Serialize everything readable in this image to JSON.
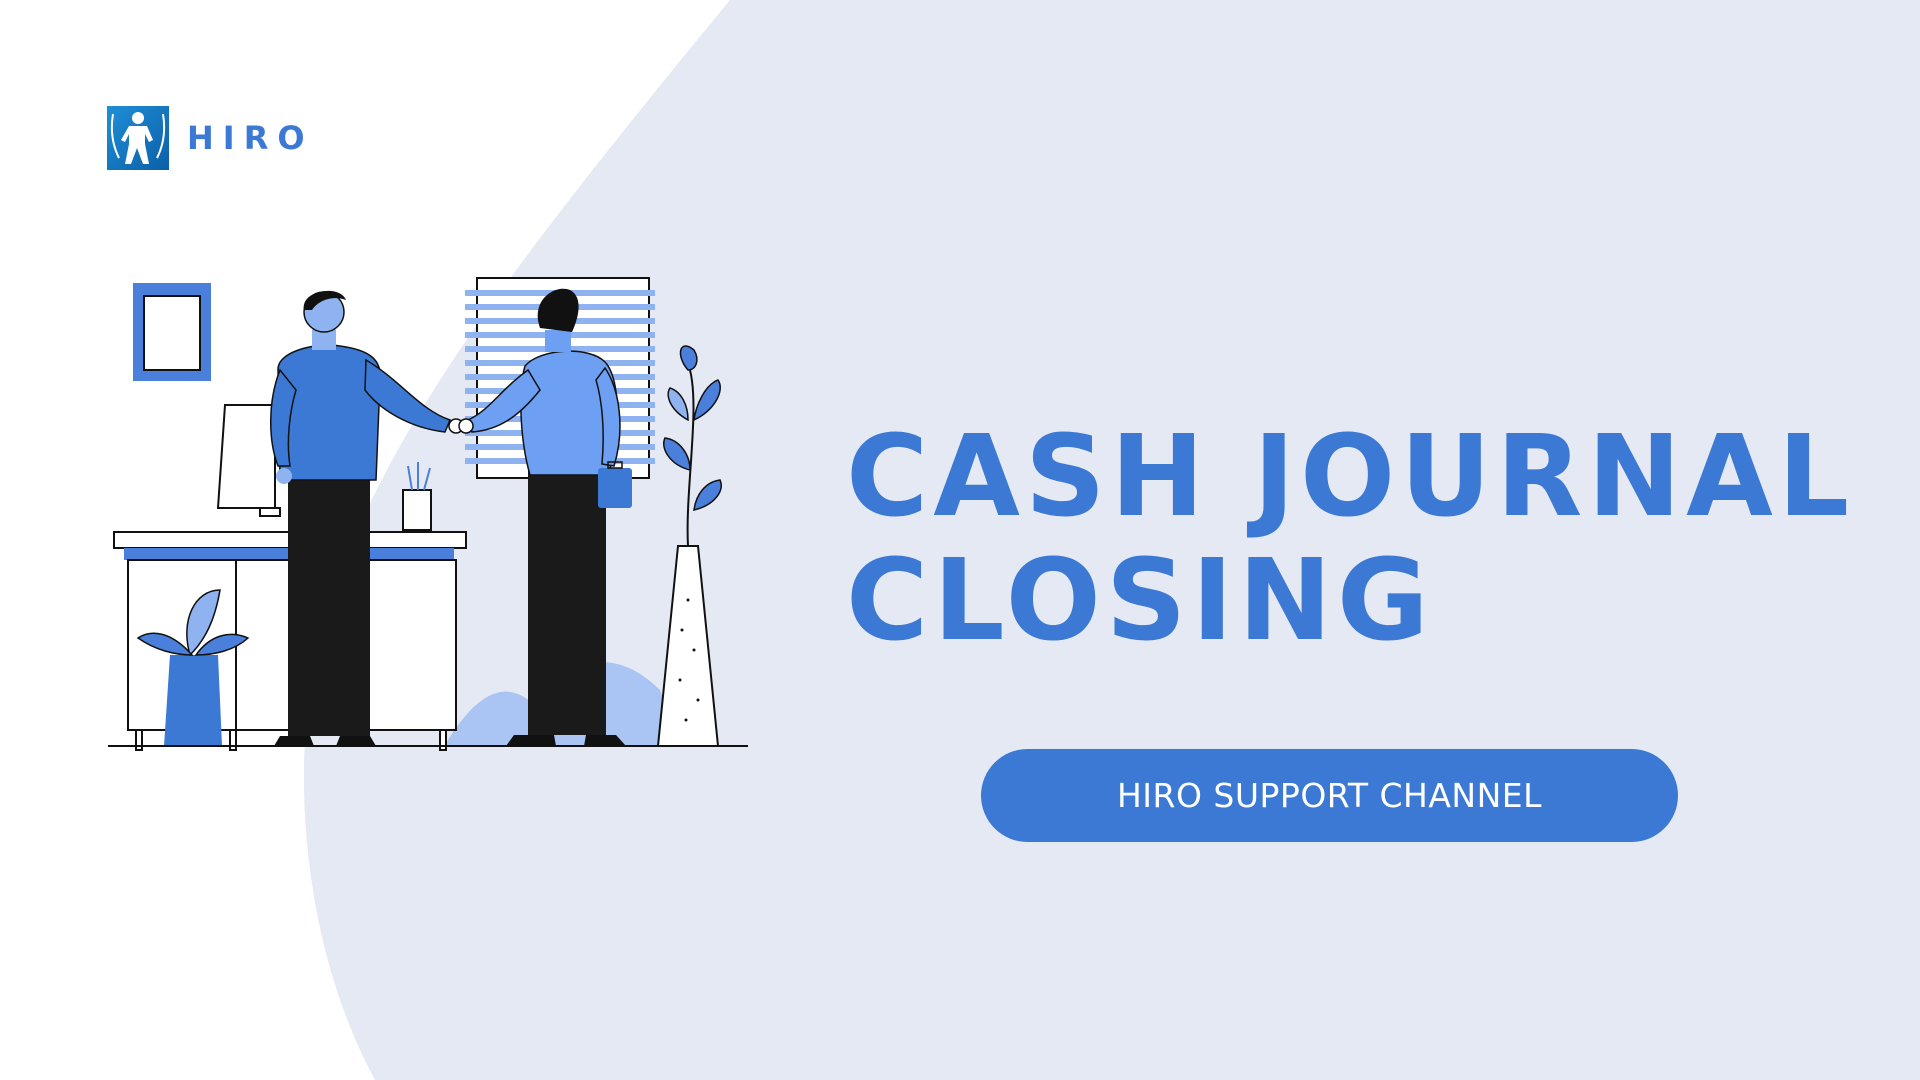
{
  "brand": {
    "name": "HIRO",
    "logo_icon": "robot-figure-icon",
    "accent_color": "#3b79d4",
    "background_shape_color": "#e4e9f4"
  },
  "slide": {
    "title_line1": "CASH JOURNAL",
    "title_line2": "CLOSING"
  },
  "cta": {
    "label": "HIRO SUPPORT CHANNEL"
  },
  "illustration": {
    "subject": "business-handshake-illustration"
  }
}
